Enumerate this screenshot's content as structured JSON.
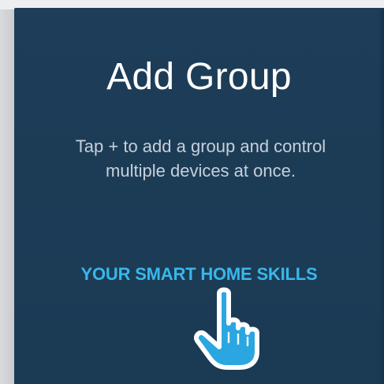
{
  "group": {
    "title": "Add Group",
    "description_line1": "Tap + to add a group and control",
    "description_line2": "multiple devices at once."
  },
  "skills": {
    "link_label": "YOUR SMART HOME SKILLS"
  },
  "icons": {
    "pointer": "hand-pointer-icon"
  },
  "colors": {
    "card_background": "#1c3c57",
    "link_color": "#39b7ea",
    "text_color": "#c7d0da",
    "title_color": "#ffffff"
  }
}
